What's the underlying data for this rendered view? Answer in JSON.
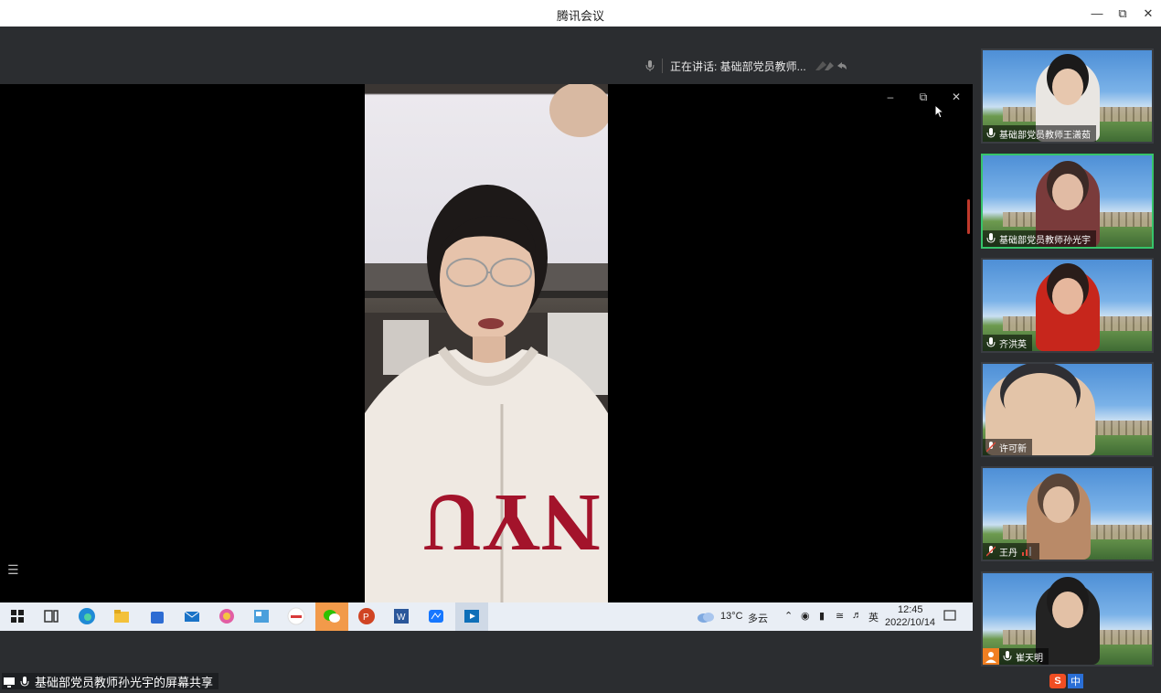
{
  "window": {
    "title": "腾讯会议"
  },
  "speaker": {
    "text": "正在讲话: 基础部党员教师..."
  },
  "share": {
    "label": "基础部党员教师孙光宇的屏幕共享"
  },
  "taskbar": {
    "weather_temp": "13°C",
    "weather_desc": "多云",
    "ime_lang": "英",
    "time": "12:45",
    "date": "2022/10/14"
  },
  "participants": [
    {
      "name": "基础部党员教师王潇茹",
      "muted": false,
      "active": false
    },
    {
      "name": "基础部党员教师孙光宇",
      "muted": false,
      "active": true
    },
    {
      "name": "齐洪英",
      "muted": false,
      "active": false
    },
    {
      "name": "许可新",
      "muted": true,
      "active": false
    },
    {
      "name": "王丹",
      "muted": true,
      "active": false
    },
    {
      "name": "崔天明",
      "muted": false,
      "active": false
    }
  ],
  "ime": {
    "logo": "S",
    "mode": "中"
  },
  "colors": {
    "active_border": "#36c46a",
    "panel_bg": "#2b2d30",
    "taskbar_bg": "#e9eef5"
  },
  "icons": [
    "minimize-icon",
    "restore-icon",
    "close-icon",
    "mic-icon",
    "list-icon",
    "windows-start-icon",
    "edge-icon",
    "folder-icon",
    "wechat-icon",
    "powerpoint-icon",
    "word-icon",
    "cloud-icon"
  ]
}
